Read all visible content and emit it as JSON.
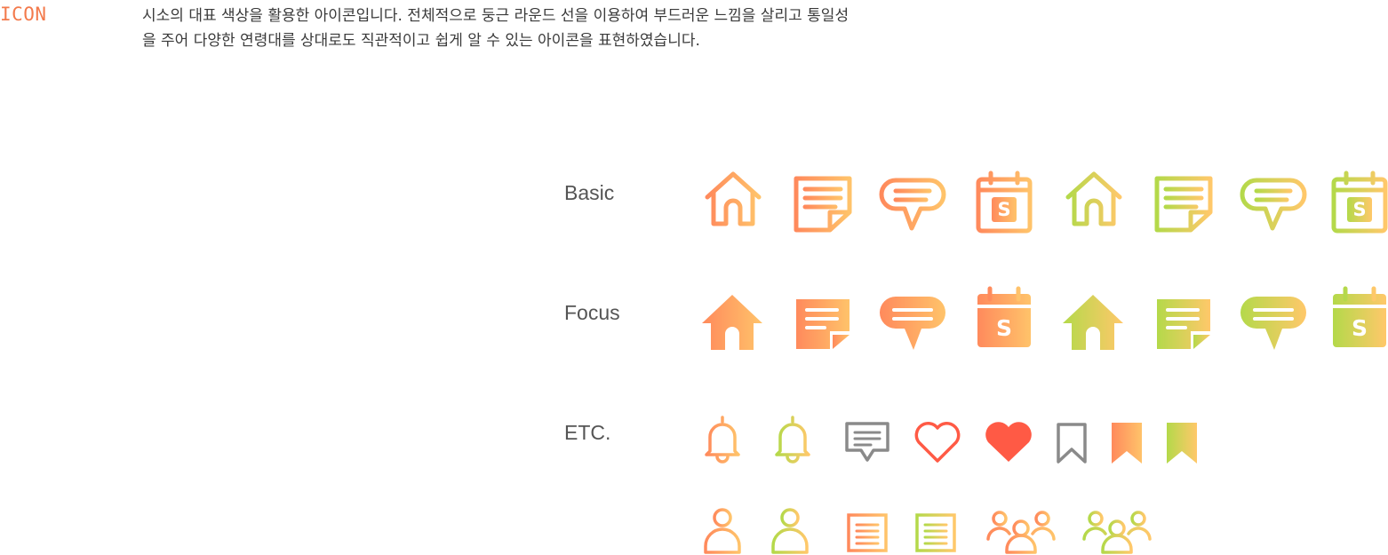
{
  "header": {
    "title": "ICON",
    "description_lines": [
      "시소의 대표 색상을 활용한 아이콘입니다. 전체적으로 둥근 라운드 선을 이용하여 부드러운 느낌을 살리고 통일성",
      "을 주어 다양한 연령대를 상대로도 직관적이고 쉽게 알 수 있는 아이콘을  표현하였습니다."
    ]
  },
  "rows": {
    "basic": "Basic",
    "focus": "Focus",
    "etc": "ETC."
  },
  "calendar_letter": "S",
  "colors": {
    "accent": "#f37a4c",
    "orange_start": "#ff8a5c",
    "orange_end": "#ffc36a",
    "green_start": "#b4d94a",
    "green_end": "#ffc86a",
    "red": "#ff5a45",
    "gray": "#8a8a8a",
    "text": "#3a3a3a",
    "label": "#555555"
  },
  "icons": {
    "basic": [
      "home-icon",
      "note-icon",
      "chat-icon",
      "calendar-icon",
      "home-icon",
      "note-icon",
      "chat-icon",
      "calendar-icon"
    ],
    "focus": [
      "home-icon",
      "note-icon",
      "chat-icon",
      "calendar-icon",
      "home-icon",
      "note-icon",
      "chat-icon",
      "calendar-icon"
    ],
    "etc_row1": [
      "bell-icon",
      "bell-icon",
      "comment-icon",
      "heart-outline-icon",
      "heart-filled-icon",
      "bookmark-outline-icon",
      "bookmark-filled-icon",
      "bookmark-filled-icon"
    ],
    "etc_row2": [
      "person-icon",
      "person-icon",
      "document-icon",
      "document-icon",
      "group-icon",
      "group-icon"
    ]
  }
}
